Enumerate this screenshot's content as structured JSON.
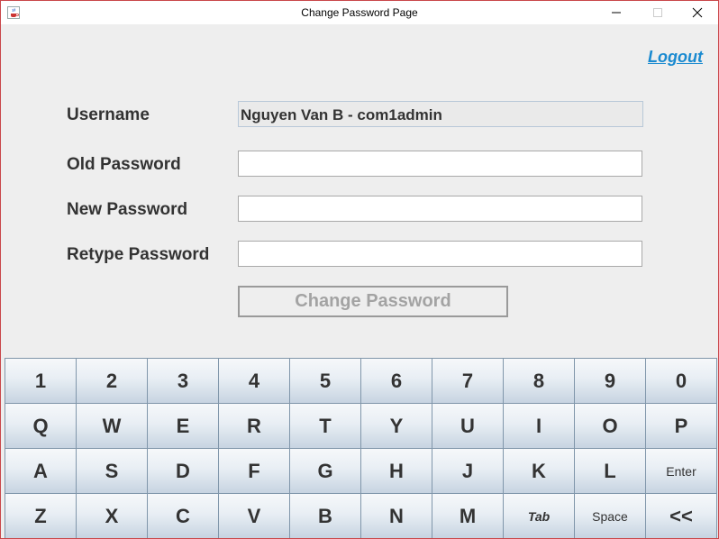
{
  "window": {
    "title": "Change Password Page",
    "icon": "java-cup-icon",
    "controls": [
      "minimize-icon",
      "maximize-icon",
      "close-icon"
    ]
  },
  "header": {
    "logout": "Logout"
  },
  "form": {
    "username_label": "Username",
    "username_value": "Nguyen Van B - com1admin",
    "old_label": "Old Password",
    "new_label": "New Password",
    "retype_label": "Retype Password",
    "old_value": "",
    "new_value": "",
    "retype_value": "",
    "submit": "Change Password"
  },
  "keyboard": {
    "rows": [
      [
        "1",
        "2",
        "3",
        "4",
        "5",
        "6",
        "7",
        "8",
        "9",
        "0"
      ],
      [
        "Q",
        "W",
        "E",
        "R",
        "T",
        "Y",
        "U",
        "I",
        "O",
        "P"
      ],
      [
        "A",
        "S",
        "D",
        "F",
        "G",
        "H",
        "J",
        "K",
        "L",
        "Enter"
      ],
      [
        "Z",
        "X",
        "C",
        "V",
        "B",
        "N",
        "M",
        "Tab",
        "Space",
        "<<"
      ]
    ]
  }
}
